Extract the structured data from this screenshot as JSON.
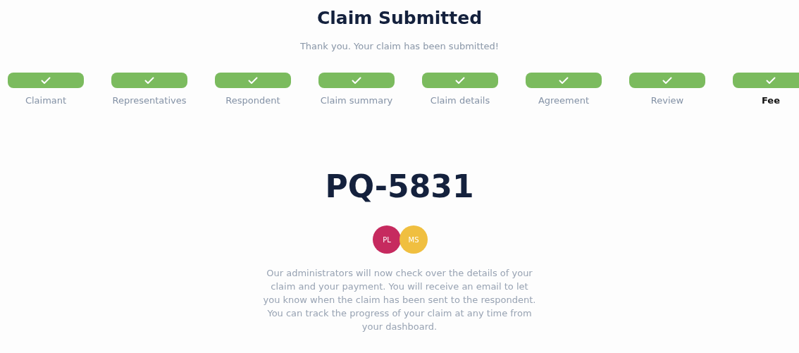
{
  "title": "Claim Submitted",
  "subtitle": "Thank you. Your claim has been submitted!",
  "steps": [
    {
      "label": "Claimant",
      "completed": true,
      "selected": false
    },
    {
      "label": "Representatives",
      "completed": true,
      "selected": false
    },
    {
      "label": "Respondent",
      "completed": true,
      "selected": false
    },
    {
      "label": "Claim summary",
      "completed": true,
      "selected": false
    },
    {
      "label": "Claim details",
      "completed": true,
      "selected": false
    },
    {
      "label": "Agreement",
      "completed": true,
      "selected": false
    },
    {
      "label": "Review",
      "completed": true,
      "selected": false
    },
    {
      "label": "Fee",
      "completed": true,
      "selected": true
    }
  ],
  "claim_number": "PQ-5831",
  "avatars": [
    {
      "initials": "PL",
      "color": "#c62a5f"
    },
    {
      "initials": "MS",
      "color": "#f0bf40"
    }
  ],
  "message": "Our administrators will now check over the details of your claim and your payment. You will receive an email to let you know when the claim has been sent to the respondent. You can track the progress of your claim at any time from your dashboard."
}
